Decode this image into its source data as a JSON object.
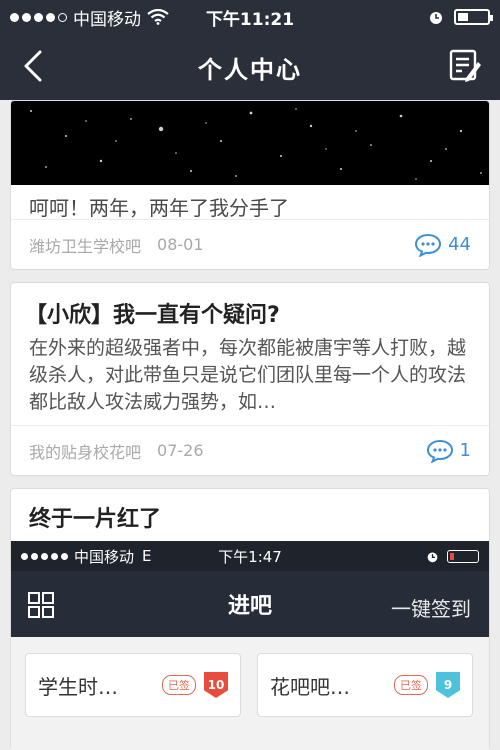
{
  "status_bar": {
    "carrier": "中国移动",
    "time": "下午11:21"
  },
  "nav": {
    "title": "个人中心",
    "back_icon": "chevron-left-icon",
    "edit_icon": "edit-note-icon"
  },
  "posts": [
    {
      "body": "呵呵！两年，两年了我分手了",
      "forum": "潍坊卫生学校吧",
      "date": "08-01",
      "comments": "44"
    },
    {
      "title": "【小欣】我一直有个疑问?",
      "excerpt": "在外来的超级强者中，每次都能被唐宇等人打败，越级杀人，对此带鱼只是说它们团队里每一个人的攻法都比敌人攻法威力强势，如…",
      "forum": "我的贴身校花吧",
      "date": "07-26",
      "comments": "1"
    },
    {
      "title": "终于一片红了"
    }
  ],
  "embedded": {
    "status_bar": {
      "carrier": "中国移动",
      "network": "E",
      "time": "下午1:47"
    },
    "nav": {
      "title": "进吧",
      "sign_all": "一键签到"
    },
    "tiles": [
      {
        "name": "学生时…",
        "signed": "已签",
        "level": "10",
        "level_color": "#e74c3c"
      },
      {
        "name": "花吧吧…",
        "signed": "已签",
        "level": "9",
        "level_color": "#4ec2dc"
      }
    ]
  },
  "colors": {
    "nav_bg": "#2a2f3a",
    "accent_blue": "#3d8fd6",
    "signed_red": "#e06b5a"
  }
}
